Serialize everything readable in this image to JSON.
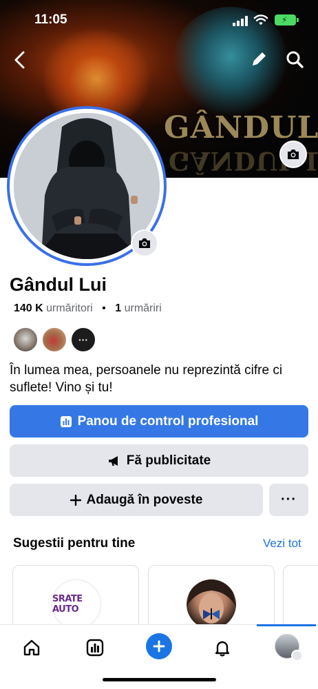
{
  "status_bar": {
    "time": "11:05"
  },
  "cover": {
    "text": "GÂNDUL LUI",
    "mirror_text": "GÂNDUL LUI"
  },
  "header_icons": [
    "back-icon",
    "pencil-icon",
    "search-icon"
  ],
  "profile": {
    "name": "Gândul Lui",
    "followers_count": "140 K",
    "followers_label": "urmăritori",
    "following_count": "1",
    "following_label": "urmăriri",
    "bio": "În lumea mea, persoanele nu reprezintă cifre ci suflete! Vino și tu!"
  },
  "actions": {
    "dashboard": "Panou de control profesional",
    "advertise": "Fă publicitate",
    "add_story": "Adaugă în poveste",
    "more": "···"
  },
  "suggestions": {
    "title": "Sugestii pentru tine",
    "see_all": "Vezi tot",
    "cards": [
      {
        "logo_text": "SRATE AUTO"
      },
      {
        "image": "woman-with-butterfly"
      }
    ]
  },
  "tabs": [
    "home-icon",
    "dashboard-icon",
    "create-icon",
    "notifications-icon",
    "profile-icon"
  ],
  "colors": {
    "primary": "#3578e5",
    "link": "#1b74e4",
    "secondary_button": "#e4e6eb",
    "avatar_ring": "#3b70e6"
  }
}
